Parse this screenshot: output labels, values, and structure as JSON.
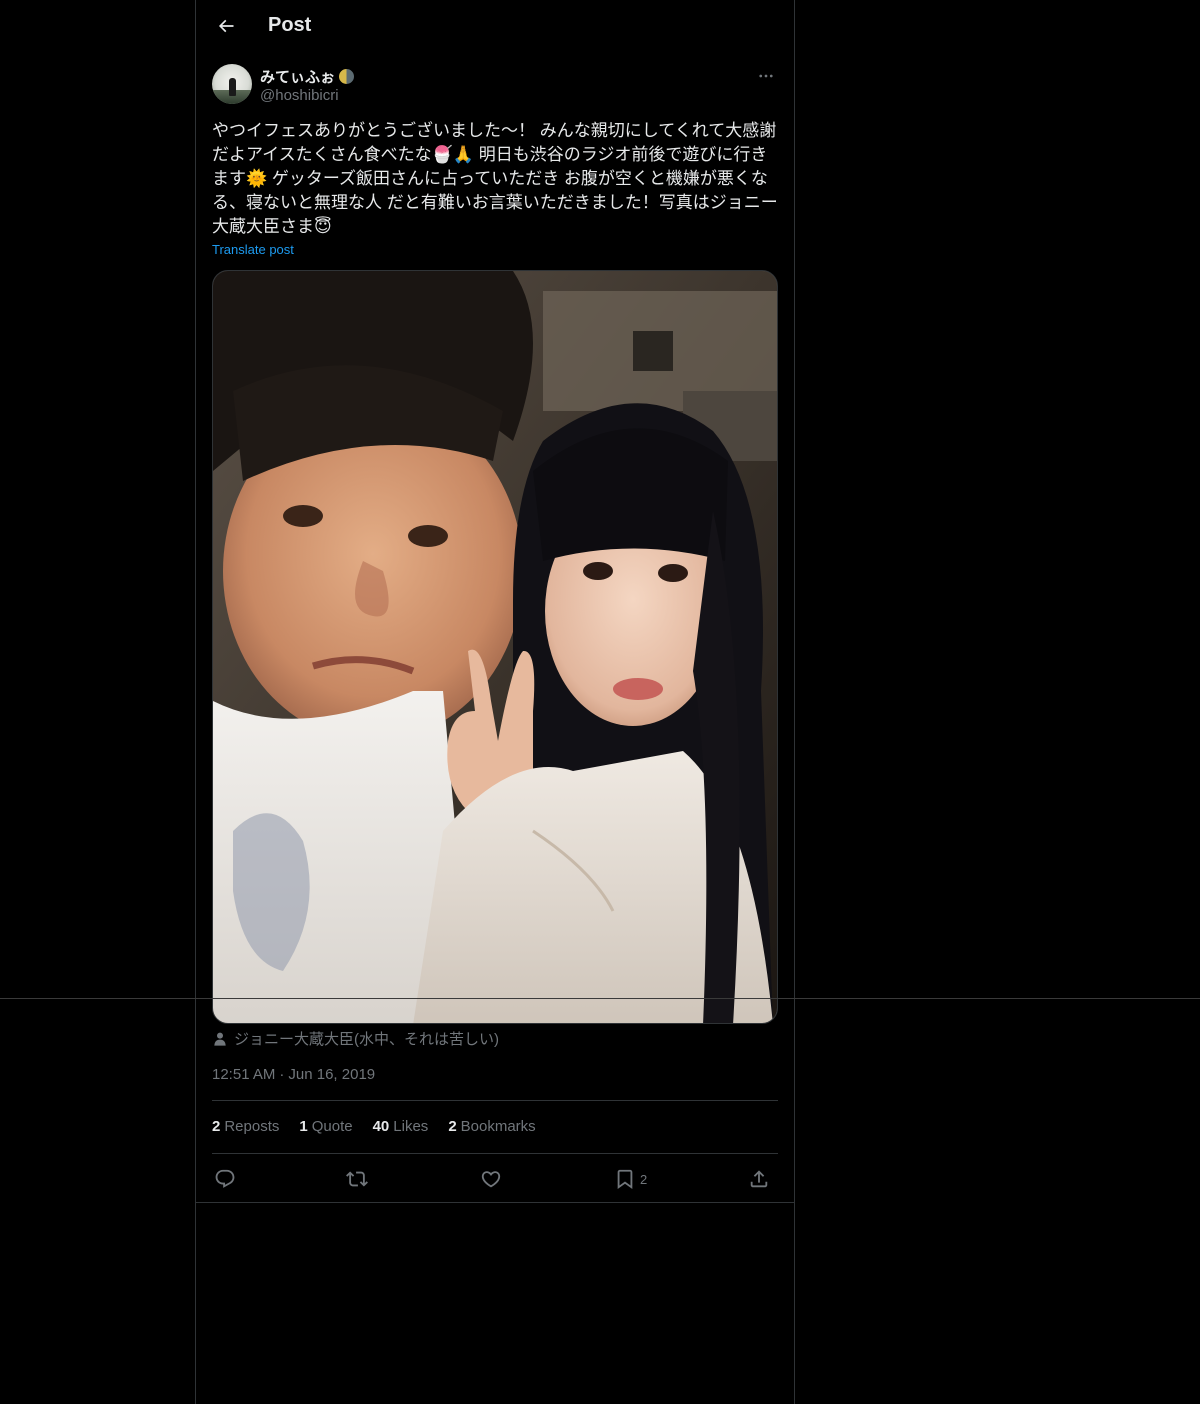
{
  "header": {
    "title": "Post",
    "back_icon": "arrow-left-icon"
  },
  "author": {
    "display_name": "みてぃふぉ",
    "name_emoji": "moon-icon",
    "handle": "@hoshibicri"
  },
  "tweet": {
    "text": "やつイフェスありがとうございました〜！ みんな親切にしてくれて大感謝だよアイスたくさん食べたな🍧🙏 明日も渋谷のラジオ前後で遊びに行きます🌞 ゲッターズ飯田さんに占っていただき お腹が空くと機嫌が悪くなる、寝ないと無理な人 だと有難いお言葉いただきました！写真はジョニー大蔵大臣さま😇",
    "translate_label": "Translate post"
  },
  "media": {
    "tagged_user": "ジョニー大蔵大臣(水中、それは苦しい)",
    "tag_icon": "person-icon"
  },
  "meta": {
    "time": "12:51 AM",
    "separator": "·",
    "date": "Jun 16, 2019"
  },
  "stats": {
    "reposts_count": "2",
    "reposts_label": "Reposts",
    "quotes_count": "1",
    "quotes_label": "Quote",
    "likes_count": "40",
    "likes_label": "Likes",
    "bookmarks_count": "2",
    "bookmarks_label": "Bookmarks"
  },
  "actions": {
    "bookmark_count": "2"
  },
  "colors": {
    "background": "#000000",
    "text": "#e7e9ea",
    "secondary": "#71767b",
    "accent": "#1d9bf0",
    "border": "#2f3336"
  }
}
